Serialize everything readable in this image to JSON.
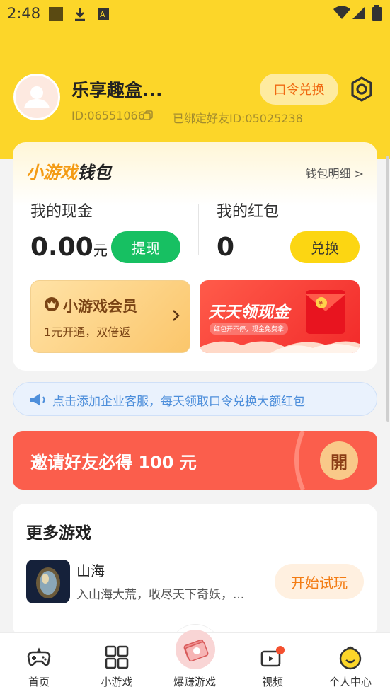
{
  "status_bar": {
    "time": "2:48"
  },
  "profile": {
    "nickname": "乐享趣盒...",
    "id_text": "ID:06551066",
    "bound_friend": "已绑定好友ID:05025238",
    "code_redeem_label": "口令兑换"
  },
  "wallet": {
    "title_part1": "小游戏",
    "title_part2": "钱包",
    "detail_link": "钱包明细 >",
    "cash_label": "我的现金",
    "cash_amount": "0.00",
    "cash_unit": "元",
    "withdraw_label": "提现",
    "redpack_label": "我的红包",
    "redpack_amount": "0",
    "exchange_label": "兑换",
    "member_title": "小游戏会员",
    "member_sub": "1元开通，双倍返",
    "cash_card_title": "天天领现金",
    "cash_card_sub": "红包开不停，现金免费拿"
  },
  "notice": {
    "text": "点击添加企业客服，每天领取口令兑换大额红包"
  },
  "invite": {
    "text": "邀请好友必得 100 元",
    "button_label": "開"
  },
  "more_games": {
    "title": "更多游戏",
    "items": [
      {
        "name": "山海",
        "desc": "入山海大荒，收尽天下奇妖，...",
        "action": "开始试玩"
      }
    ]
  },
  "tabbar": {
    "items": [
      {
        "label": "首页",
        "icon": "gamepad-icon"
      },
      {
        "label": "小游戏",
        "icon": "grid-icon"
      },
      {
        "label": "爆赚游戏",
        "icon": "money-icon"
      },
      {
        "label": "视频",
        "icon": "video-icon"
      },
      {
        "label": "个人中心",
        "icon": "smile-icon"
      }
    ]
  },
  "colors": {
    "brand_yellow": "#fcd629",
    "withdraw_green": "#17c062",
    "invite_red": "#fb5e4c",
    "notice_blue": "#4e8fdb",
    "accent_orange": "#f37c14"
  }
}
